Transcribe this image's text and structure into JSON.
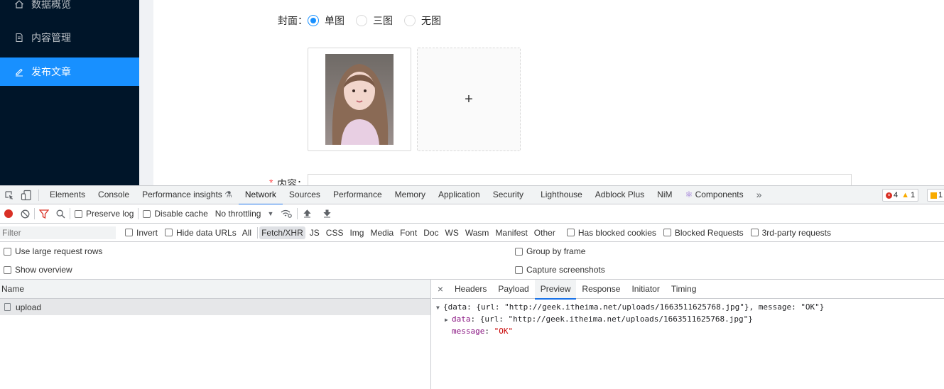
{
  "sidebar": {
    "items": [
      {
        "label": "数据概览",
        "icon": "home-icon"
      },
      {
        "label": "内容管理",
        "icon": "file-icon"
      },
      {
        "label": "发布文章",
        "icon": "edit-icon",
        "active": true
      }
    ],
    "background": "#001529",
    "active_color": "#1890ff"
  },
  "form": {
    "cover_label": "封面：",
    "cover_options": [
      {
        "label": "单图",
        "checked": true
      },
      {
        "label": "三图",
        "checked": false
      },
      {
        "label": "无图",
        "checked": false
      }
    ],
    "upload_plus": "+",
    "content_label_required": "*",
    "content_label": "内容："
  },
  "devtools": {
    "tabs": [
      "Elements",
      "Console",
      "Performance insights",
      "Network",
      "Sources",
      "Performance",
      "Memory",
      "Application",
      "Security",
      "Lighthouse",
      "Adblock Plus",
      "NiM",
      "Components"
    ],
    "active_tab": "Network",
    "more": "»",
    "errors": "4",
    "warnings": "1",
    "info": "1",
    "toolbar": {
      "preserve_log": "Preserve log",
      "disable_cache": "Disable cache",
      "throttling": "No throttling"
    },
    "filter": {
      "placeholder": "Filter",
      "invert": "Invert",
      "hide_data_urls": "Hide data URLs",
      "types": [
        "All",
        "Fetch/XHR",
        "JS",
        "CSS",
        "Img",
        "Media",
        "Font",
        "Doc",
        "WS",
        "Wasm",
        "Manifest",
        "Other"
      ],
      "active_type": "Fetch/XHR",
      "has_blocked_cookies": "Has blocked cookies",
      "blocked_requests": "Blocked Requests",
      "third_party": "3rd-party requests"
    },
    "settings": {
      "large_rows": "Use large request rows",
      "show_overview": "Show overview",
      "group_by_frame": "Group by frame",
      "capture_screenshots": "Capture screenshots"
    },
    "list": {
      "header": "Name",
      "rows": [
        "upload"
      ]
    },
    "detail": {
      "close": "×",
      "tabs": [
        "Headers",
        "Payload",
        "Preview",
        "Response",
        "Initiator",
        "Timing"
      ],
      "active_tab": "Preview",
      "preview_line1": "{data: {url: \"http://geek.itheima.net/uploads/1663511625768.jpg\"}, message: \"OK\"}",
      "data_key": "data",
      "data_value": "{url: \"http://geek.itheima.net/uploads/1663511625768.jpg\"}",
      "message_key": "message",
      "message_value": "\"OK\""
    }
  }
}
